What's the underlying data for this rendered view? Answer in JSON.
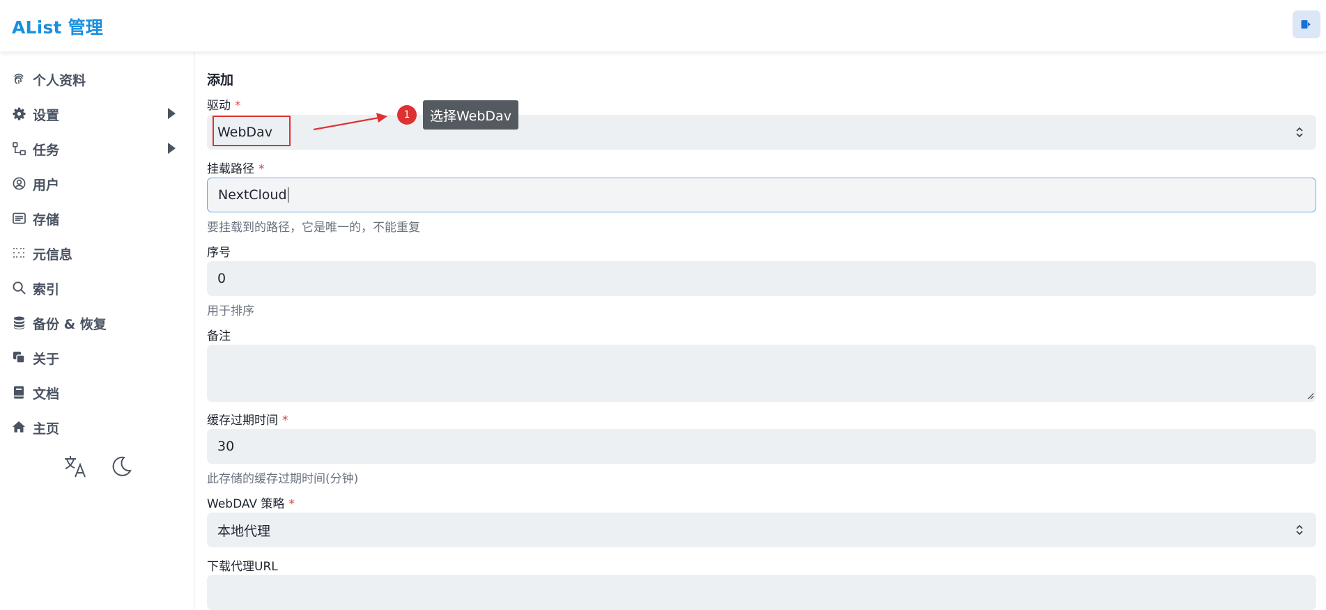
{
  "header": {
    "title": "AList 管理",
    "logout_icon": "logout-icon",
    "accent_color": "#1890e0"
  },
  "sidebar": {
    "items": [
      {
        "label": "个人资料",
        "icon": "fingerprint-icon"
      },
      {
        "label": "设置",
        "icon": "gear-icon",
        "has_submenu": true
      },
      {
        "label": "任务",
        "icon": "workflow-icon",
        "has_submenu": true
      },
      {
        "label": "用户",
        "icon": "user-circle-icon"
      },
      {
        "label": "存储",
        "icon": "storage-icon"
      },
      {
        "label": "元信息",
        "icon": "grid-dots-icon"
      },
      {
        "label": "索引",
        "icon": "search-icon"
      },
      {
        "label": "备份 & 恢复",
        "icon": "database-icon"
      },
      {
        "label": "关于",
        "icon": "copy-icon"
      },
      {
        "label": "文档",
        "icon": "book-icon"
      },
      {
        "label": "主页",
        "icon": "home-icon"
      }
    ],
    "tools": [
      "translate-icon",
      "moon-icon"
    ]
  },
  "form": {
    "section_title": "添加",
    "driver": {
      "label": "驱动",
      "value": "WebDav"
    },
    "mount_path": {
      "label": "挂载路径",
      "value": "NextCloud",
      "help": "要挂载到的路径，它是唯一的，不能重复"
    },
    "order": {
      "label": "序号",
      "value": "0",
      "help": "用于排序"
    },
    "remark": {
      "label": "备注",
      "value": ""
    },
    "cache_expiration": {
      "label": "缓存过期时间",
      "value": "30",
      "help": "此存储的缓存过期时间(分钟)"
    },
    "webdav_policy": {
      "label": "WebDAV 策略",
      "value": "本地代理"
    },
    "download_proxy_url": {
      "label": "下载代理URL",
      "value": ""
    },
    "required_mark": "*"
  },
  "annotation": {
    "badge": "1",
    "tooltip": "选择WebDav",
    "color": "#e03131"
  }
}
